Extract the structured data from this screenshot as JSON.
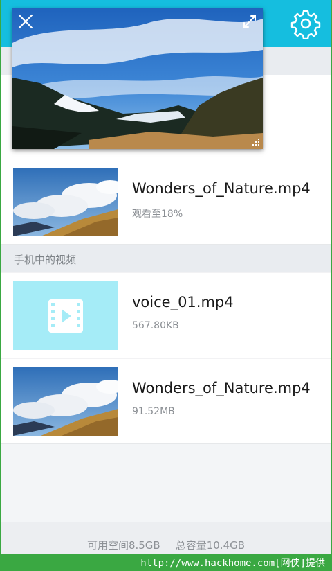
{
  "colors": {
    "header": "#15bedf",
    "watermark_bg": "#3aa842",
    "placeholder_thumb": "#a5ecf7"
  },
  "header": {
    "settings_icon": "gear-icon"
  },
  "player": {
    "close_icon": "close-icon",
    "expand_icon": "expand-icon",
    "resize_icon": "resize-grip-icon"
  },
  "history": [
    {
      "title": "Wonders_of_Nature.mp4",
      "subtitle": "观看至18%",
      "progress": 0.18
    }
  ],
  "phone_section": {
    "label": "手机中的视频"
  },
  "phone_videos": [
    {
      "title": "voice_01.mp4",
      "size": "567.80KB",
      "thumb_icon": "video-file-icon"
    },
    {
      "title": "Wonders_of_Nature.mp4",
      "size": "91.52MB"
    }
  ],
  "storage": {
    "available": "可用空间8.5GB",
    "total": "总容量10.4GB"
  },
  "watermark": {
    "text": "http://www.hackhome.com[网侠]提供"
  }
}
